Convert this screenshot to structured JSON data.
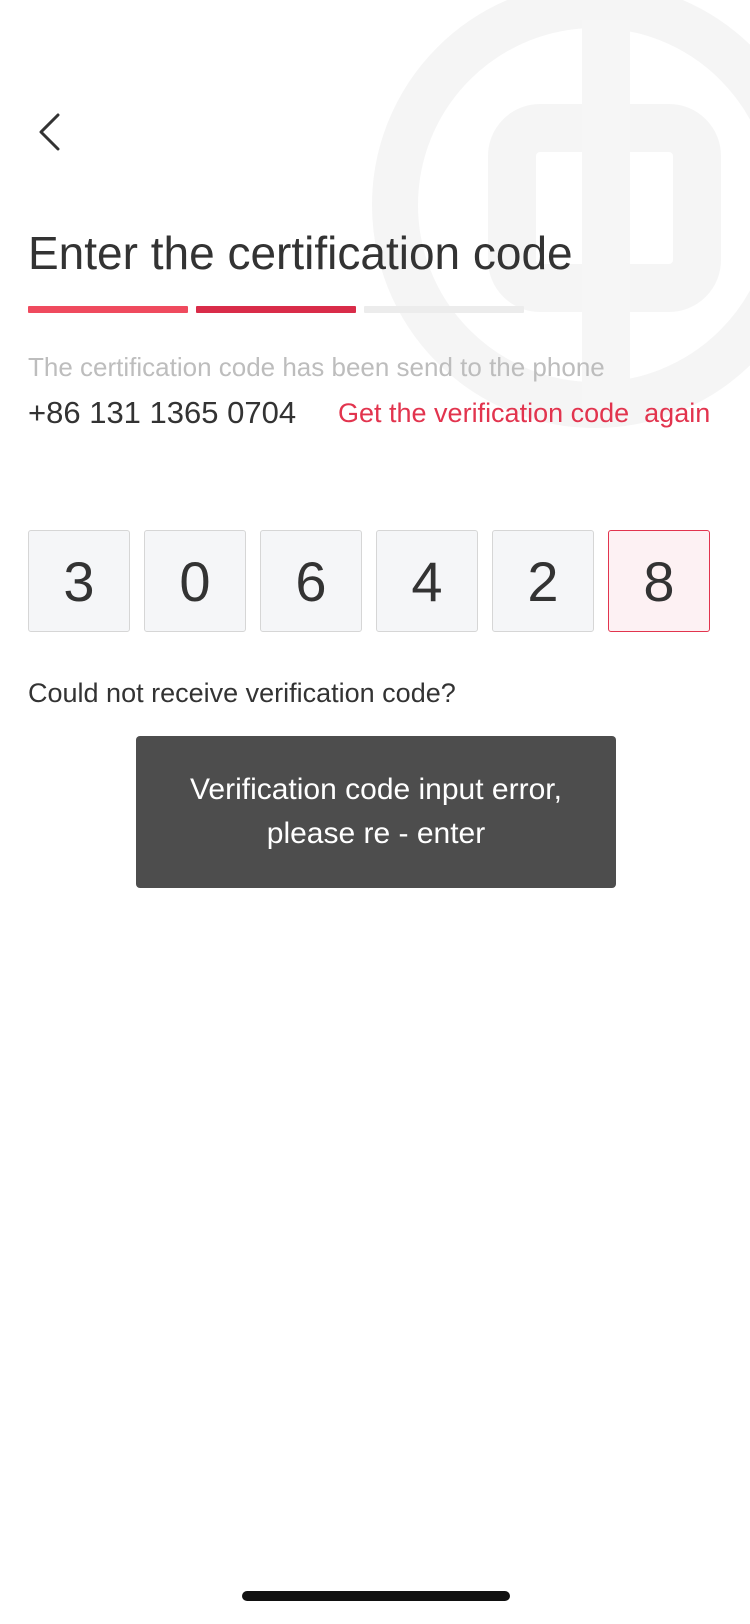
{
  "header": {
    "back_icon": "chevron-left-icon",
    "title": "Enter the certification code"
  },
  "progress": {
    "steps": [
      {
        "state": "done",
        "color": "#ef4a5e"
      },
      {
        "state": "current",
        "color": "#d92c49"
      },
      {
        "state": "pending",
        "color": "#ececec"
      }
    ]
  },
  "message": {
    "subtitle": "The certification code has been send to the phone",
    "phone": "+86 131 1365 0704",
    "resend_label": "Get the verification code  again"
  },
  "code": {
    "digits": [
      "3",
      "0",
      "6",
      "4",
      "2",
      "8"
    ],
    "active_index": 5
  },
  "help": {
    "label": "Could not receive verification code?"
  },
  "toast": {
    "message": "Verification code input error, please re - enter"
  },
  "colors": {
    "accent": "#e2344e",
    "text": "#333333",
    "muted": "#bdbdbd",
    "toast_bg": "#4d4d4d"
  }
}
